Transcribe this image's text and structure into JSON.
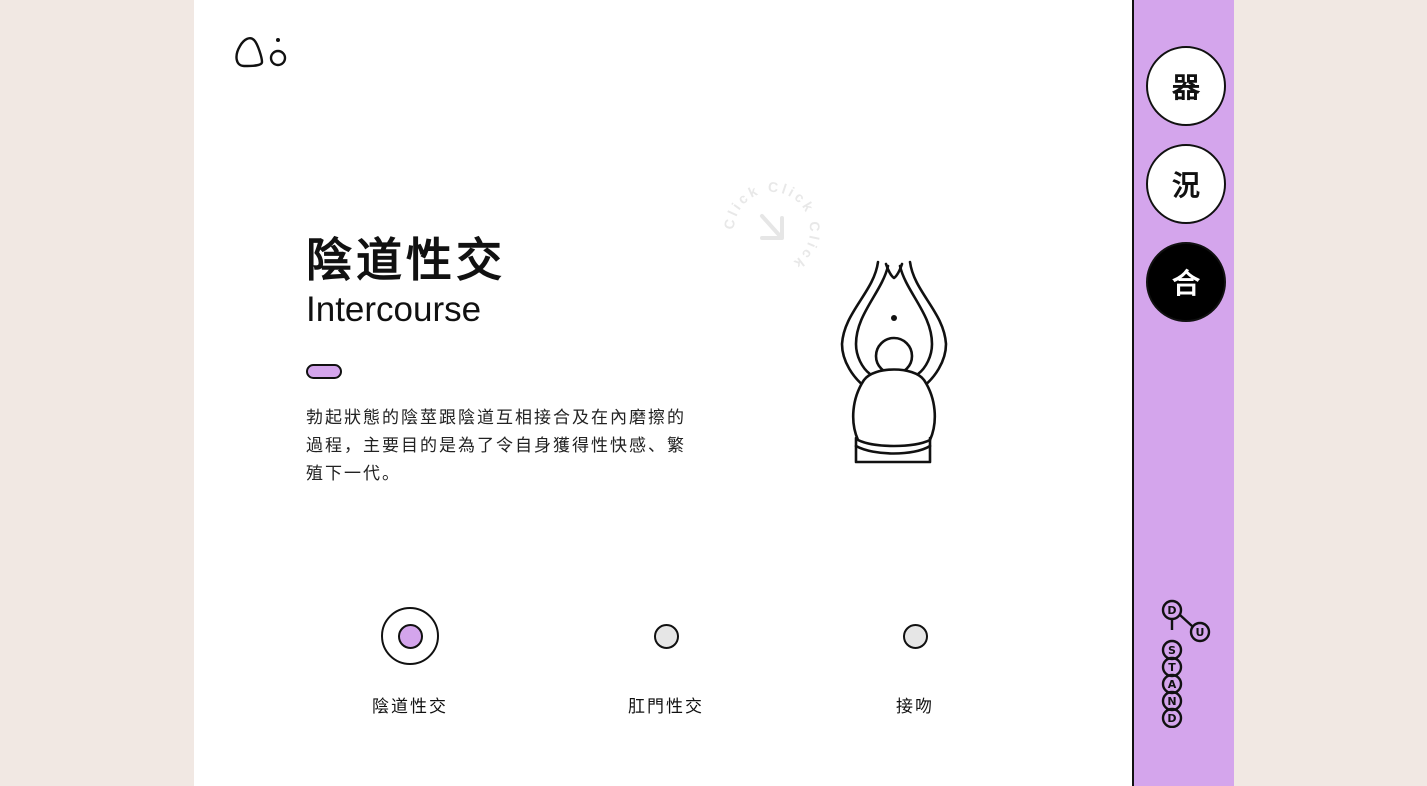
{
  "header": {
    "logo_icon": "bubbles-logo"
  },
  "hero": {
    "title_zh": "陰道性交",
    "title_en": "Intercourse",
    "description": "勃起狀態的陰莖跟陰道互相接合及在內磨擦的過程，主要目的是為了令自身獲得性快感、繁殖下一代。",
    "click_hint": "Click Click Click",
    "illustration_icon": "intercourse-illustration"
  },
  "options": [
    {
      "label": "陰道性交",
      "selected": true
    },
    {
      "label": "肛門性交",
      "selected": false
    },
    {
      "label": "接吻",
      "selected": false
    }
  ],
  "sidebar": {
    "items": [
      {
        "label": "器",
        "active": false
      },
      {
        "label": "況",
        "active": false
      },
      {
        "label": "合",
        "active": true
      }
    ],
    "brand_text": "D-U-STAND"
  },
  "colors": {
    "accent": "#d4a5ec",
    "background": "#f1e8e3",
    "card": "#ffffff",
    "ink": "#111111"
  }
}
